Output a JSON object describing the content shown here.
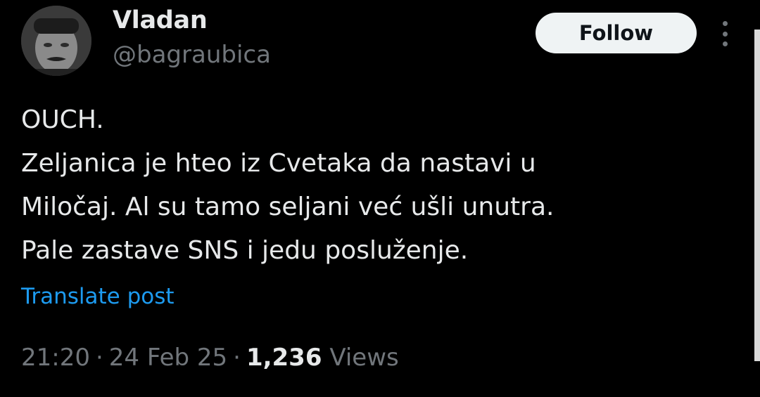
{
  "author": {
    "display_name": "Vladan",
    "handle": "@bagraubica"
  },
  "actions": {
    "follow_label": "Follow"
  },
  "tweet": {
    "lines": [
      "OUCH.",
      "Zeljanica je hteo iz Cvetaka da nastavi u",
      "Miločaj. Al su tamo seljani već ušli unutra.",
      "Pale zastave SNS i jedu posluženje."
    ],
    "translate_label": "Translate post",
    "time": "21:20",
    "date": "24 Feb 25",
    "views_count": "1,236",
    "views_label": "Views",
    "separator": "·"
  },
  "colors": {
    "background": "#000000",
    "text_primary": "#e7e9ea",
    "text_secondary": "#71767b",
    "link": "#1d9bf0",
    "follow_bg": "#eff3f4"
  },
  "icons": {
    "more": "more-vertical-icon",
    "avatar": "avatar"
  }
}
